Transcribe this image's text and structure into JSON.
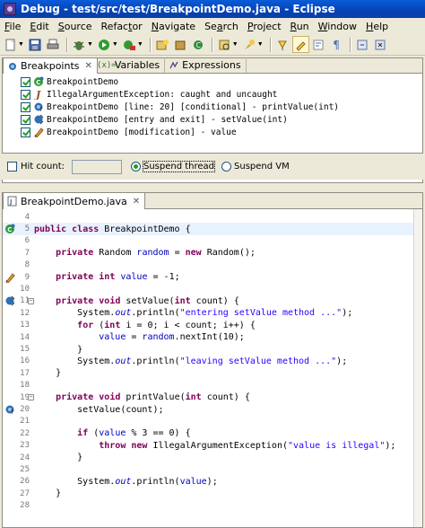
{
  "window": {
    "title": "Debug - test/src/test/BreakpointDemo.java - Eclipse"
  },
  "menu": [
    {
      "label": "File",
      "mnemonic": "F"
    },
    {
      "label": "Edit",
      "mnemonic": "E"
    },
    {
      "label": "Source",
      "mnemonic": "S"
    },
    {
      "label": "Refactor",
      "mnemonic": "t"
    },
    {
      "label": "Navigate",
      "mnemonic": "N"
    },
    {
      "label": "Search",
      "mnemonic": "a"
    },
    {
      "label": "Project",
      "mnemonic": "P"
    },
    {
      "label": "Run",
      "mnemonic": "R"
    },
    {
      "label": "Window",
      "mnemonic": "W"
    },
    {
      "label": "Help",
      "mnemonic": "H"
    }
  ],
  "breakpoints_view": {
    "tabs": [
      {
        "label": "Breakpoints",
        "icon": "breakpoint-icon",
        "active": true
      },
      {
        "label": "Variables",
        "icon": "variables-icon",
        "active": false
      },
      {
        "label": "Expressions",
        "icon": "expressions-icon",
        "active": false
      }
    ],
    "items": [
      {
        "label": "BreakpointDemo",
        "icon": "class-load-breakpoint-icon",
        "checked": true
      },
      {
        "label": "IllegalArgumentException: caught and uncaught",
        "icon": "exception-breakpoint-icon",
        "checked": true
      },
      {
        "label": "BreakpointDemo [line: 20] [conditional] - printValue(int)",
        "icon": "line-breakpoint-icon",
        "checked": true
      },
      {
        "label": "BreakpointDemo [entry and exit] - setValue(int)",
        "icon": "method-breakpoint-icon",
        "checked": true
      },
      {
        "label": "BreakpointDemo [modification] - value",
        "icon": "watchpoint-icon",
        "checked": true
      }
    ],
    "options": {
      "hit_count_label": "Hit count:",
      "hit_count_checked": false,
      "hit_count_value": "",
      "suspend_thread_label": "Suspend thread",
      "suspend_vm_label": "Suspend VM",
      "selected": "suspend_thread"
    }
  },
  "editor": {
    "tab_label": "BreakpointDemo.java",
    "current_line": 5,
    "lines": [
      {
        "n": "4",
        "text": ""
      },
      {
        "n": "5",
        "text": "public class BreakpointDemo {"
      },
      {
        "n": "6",
        "text": ""
      },
      {
        "n": "7",
        "text": "    private Random random = new Random();"
      },
      {
        "n": "8",
        "text": ""
      },
      {
        "n": "9",
        "text": "    private int value = -1;"
      },
      {
        "n": "10",
        "text": ""
      },
      {
        "n": "11",
        "text": "    private void setValue(int count) {"
      },
      {
        "n": "12",
        "text": "        System.out.println(\"entering setValue method ...\");"
      },
      {
        "n": "13",
        "text": "        for (int i = 0; i < count; i++) {"
      },
      {
        "n": "14",
        "text": "            value = random.nextInt(10);"
      },
      {
        "n": "15",
        "text": "        }"
      },
      {
        "n": "16",
        "text": "        System.out.println(\"leaving setValue method ...\");"
      },
      {
        "n": "17",
        "text": "    }"
      },
      {
        "n": "18",
        "text": ""
      },
      {
        "n": "19",
        "text": "    private void printValue(int count) {"
      },
      {
        "n": "20",
        "text": "        setValue(count);"
      },
      {
        "n": "21",
        "text": ""
      },
      {
        "n": "22",
        "text": "        if (value % 3 == 0) {"
      },
      {
        "n": "23",
        "text": "            throw new IllegalArgumentException(\"value is illegal\");"
      },
      {
        "n": "24",
        "text": "        }"
      },
      {
        "n": "25",
        "text": ""
      },
      {
        "n": "26",
        "text": "        System.out.println(value);"
      },
      {
        "n": "27",
        "text": "    }"
      },
      {
        "n": "28",
        "text": ""
      }
    ],
    "gutter_marks": {
      "5": "class-load-breakpoint-icon",
      "9": "watchpoint-icon",
      "11": "method-breakpoint-icon",
      "20": "line-breakpoint-icon"
    },
    "fold_lines": [
      "11",
      "19"
    ]
  },
  "colors": {
    "keyword": "#7f0055",
    "field": "#0000c0",
    "string": "#2a00ff",
    "current_line": "#e8f2fe"
  }
}
